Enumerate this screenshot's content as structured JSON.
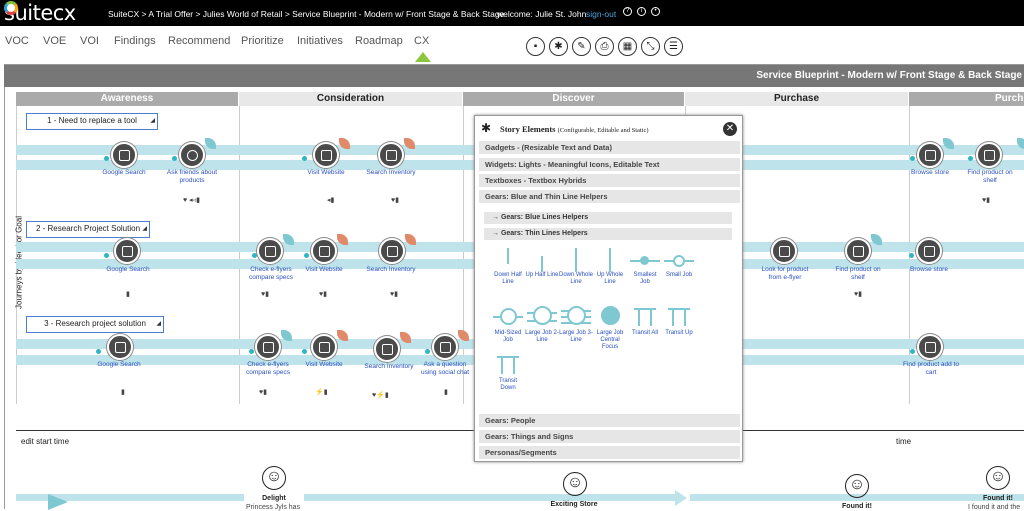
{
  "app": {
    "logo": "suitecx",
    "crumbs": "SuiteCX > A Trial Offer > Julies World of Retail > Service Blueprint - Modern w/ Front Stage & Back Stage",
    "crumb_home": "SuiteCX",
    "welcome": "welcome:  Julie St. John",
    "signout": "sign-out"
  },
  "nav": [
    {
      "label": "VOC"
    },
    {
      "label": "VOE"
    },
    {
      "label": "VOI"
    },
    {
      "label": "Findings"
    },
    {
      "label": "Recommend"
    },
    {
      "label": "Prioritize"
    },
    {
      "label": "Initiatives"
    },
    {
      "label": "Roadmap"
    },
    {
      "label": "CX"
    }
  ],
  "toolbar_icons": [
    "note-icon",
    "asterisk-icon",
    "edit-icon",
    "print-icon",
    "map-icon",
    "resize-icon",
    "database-icon"
  ],
  "blueprint": {
    "title": "Service Blueprint - Modern w/ Front Stage & Back Stage",
    "y_label": "Journeys by Need or Goal",
    "stages": [
      "Awareness",
      "Consideration",
      "Discover",
      "Purchase",
      "Purch"
    ],
    "journeys": [
      "1 - Need to replace a tool",
      "2 - Research Project Solution",
      "3 - Research project solution"
    ],
    "row1": [
      "Google Search",
      "Ask friends about products",
      "Visit Website",
      "Search Inventory",
      "Browse store",
      "Find product on shelf"
    ],
    "row2": [
      "Google Search",
      "Check e-flyers compare specs",
      "Visit Website",
      "Search Inventory",
      "Look for product from e-flyer",
      "Find product on shelf",
      "Browse store"
    ],
    "row3": [
      "Google Search",
      "Check e-flyers compare specs",
      "Visit Website",
      "Search Inventory",
      "Ask a question using social chat",
      "Find product add to cart"
    ],
    "edit_start": "edit start time",
    "time": "time",
    "emotions": [
      "Delight",
      "Exciting Store",
      "Found it!",
      "Found it!"
    ],
    "emotion_notes": [
      "Princess Jyls has",
      "I found it and the"
    ]
  },
  "modal": {
    "title": "Story Elements",
    "subtitle": "(Configurable, Editable and Static)",
    "sections": [
      "Gadgets - (Resizable Text and Data)",
      "Widgets: Lights - Meaningful Icons, Editable Text",
      "Textboxes - Textbox Hybrids",
      "Gears: Blue and Thin Line Helpers"
    ],
    "subs": [
      "→ Gears: Blue Lines Helpers",
      "→ Gears: Thin Lines Helpers"
    ],
    "tiles": [
      "Down Half Line",
      "Up Half Line",
      "Down Whole Line",
      "Up Whole Line",
      "Smallest Job",
      "Small Job",
      "Mid-Sized Job",
      "Large Job 2-Line",
      "Large Job 3-Line",
      "Large Job Central Focus",
      "Transit All",
      "Transit Up",
      "Transit Down"
    ],
    "bottom_sections": [
      "Gears: People",
      "Gears: Things and Signs",
      "Personas/Segments"
    ]
  },
  "colors": {
    "lane": "#bfe3ea",
    "accent": "#8cc63f",
    "flag": "#e08a6a",
    "flag2": "#7fc8d2",
    "link": "#2a4fc0"
  }
}
